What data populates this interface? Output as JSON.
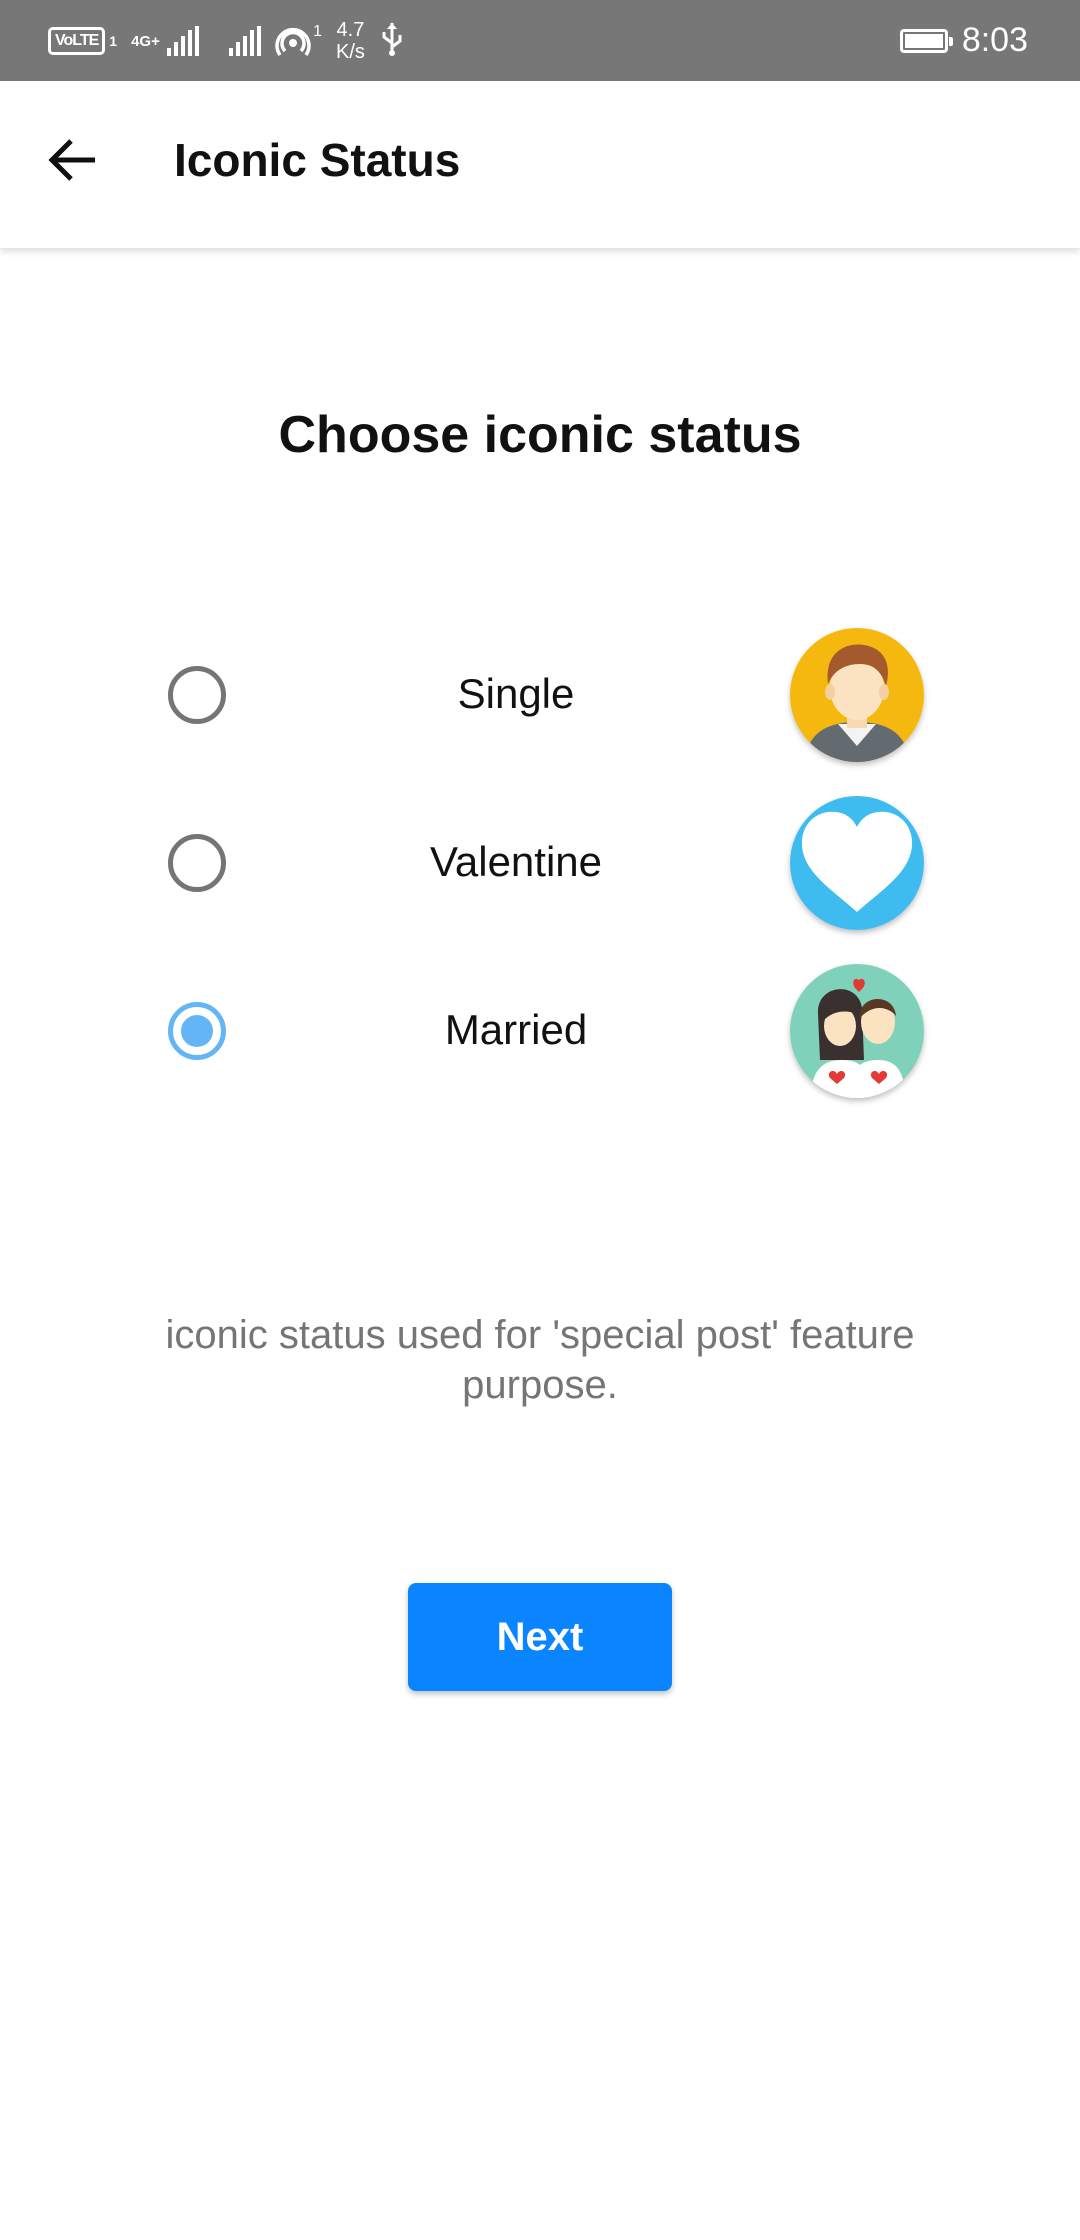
{
  "status_bar": {
    "volte": "VoLTE",
    "sim": "1",
    "network": "4G+",
    "hotspot_count": "1",
    "speed_value": "4.7",
    "speed_unit": "K/s",
    "time": "8:03",
    "icons": [
      "signal-icon",
      "signal-icon",
      "hotspot-icon",
      "usb-icon",
      "battery-icon"
    ]
  },
  "app_bar": {
    "title": "Iconic Status",
    "back_icon": "back-arrow-icon"
  },
  "main": {
    "heading": "Choose iconic status",
    "options": [
      {
        "label": "Single",
        "selected": false,
        "icon": "single-avatar-icon"
      },
      {
        "label": "Valentine",
        "selected": false,
        "icon": "heart-icon"
      },
      {
        "label": "Married",
        "selected": true,
        "icon": "couple-icon"
      }
    ],
    "note": "iconic status used for  'special post' feature purpose.",
    "next_label": "Next"
  },
  "colors": {
    "status_bar": "#777777",
    "accent": "#0a84ff",
    "radio_selected": "#64b5f6",
    "radio_unselected": "#757575",
    "note_text": "#757575"
  }
}
